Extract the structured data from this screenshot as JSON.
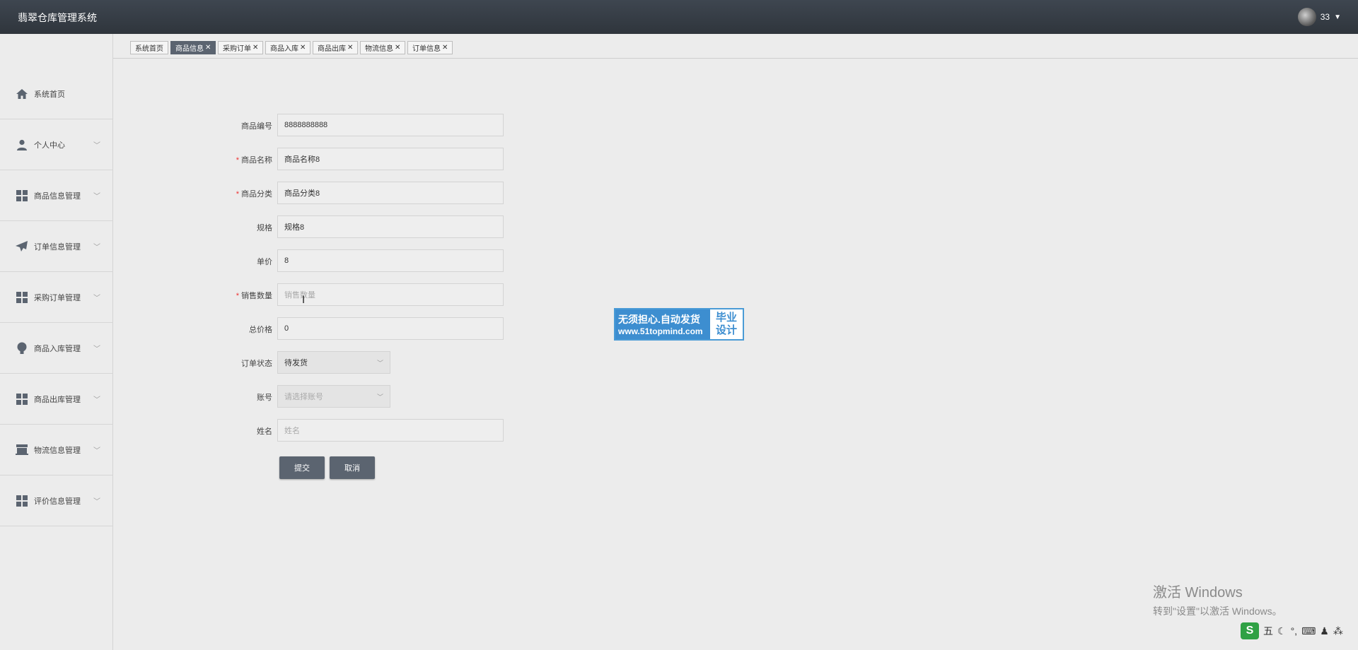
{
  "header": {
    "app_title": "翡翠仓库管理系统",
    "username": "33"
  },
  "sidebar": {
    "items": [
      {
        "label": "系统首页",
        "icon": "home-icon"
      },
      {
        "label": "个人中心",
        "icon": "user-icon"
      },
      {
        "label": "商品信息管理",
        "icon": "grid-icon"
      },
      {
        "label": "订单信息管理",
        "icon": "send-icon"
      },
      {
        "label": "采购订单管理",
        "icon": "grid-icon"
      },
      {
        "label": "商品入库管理",
        "icon": "bulb-icon"
      },
      {
        "label": "商品出库管理",
        "icon": "grid-icon"
      },
      {
        "label": "物流信息管理",
        "icon": "store-icon"
      },
      {
        "label": "评价信息管理",
        "icon": "grid-icon"
      }
    ]
  },
  "tabs": [
    {
      "label": "系统首页",
      "active": false
    },
    {
      "label": "商品信息",
      "active": true
    },
    {
      "label": "采购订单",
      "active": false
    },
    {
      "label": "商品入库",
      "active": false
    },
    {
      "label": "商品出库",
      "active": false
    },
    {
      "label": "物流信息",
      "active": false
    },
    {
      "label": "订单信息",
      "active": false
    }
  ],
  "form": {
    "product_no": {
      "label": "商品编号",
      "value": "8888888888"
    },
    "product_name": {
      "label": "商品名称",
      "value": "商品名称8"
    },
    "category": {
      "label": "商品分类",
      "value": "商品分类8"
    },
    "spec": {
      "label": "规格",
      "value": "规格8"
    },
    "unit_price": {
      "label": "单价",
      "value": "8"
    },
    "sales_qty": {
      "label": "销售数量",
      "placeholder": "销售数量"
    },
    "total_price": {
      "label": "总价格",
      "value": "0"
    },
    "order_status": {
      "label": "订单状态",
      "value": "待发货"
    },
    "account": {
      "label": "账号",
      "placeholder": "请选择账号"
    },
    "name": {
      "label": "姓名",
      "placeholder": "姓名"
    },
    "submit_label": "提交",
    "cancel_label": "取消"
  },
  "ad_watermark": {
    "line1": "无须担心.自动发货",
    "line2": "www.51topmind.com",
    "right1": "毕业",
    "right2": "设计"
  },
  "windows_activation": {
    "title": "激活 Windows",
    "subtitle": "转到\"设置\"以激活 Windows。"
  },
  "ime": {
    "mode": "五"
  },
  "colors": {
    "header_bg": "#353c44",
    "accent": "#5b6470",
    "required": "#ee3333"
  }
}
